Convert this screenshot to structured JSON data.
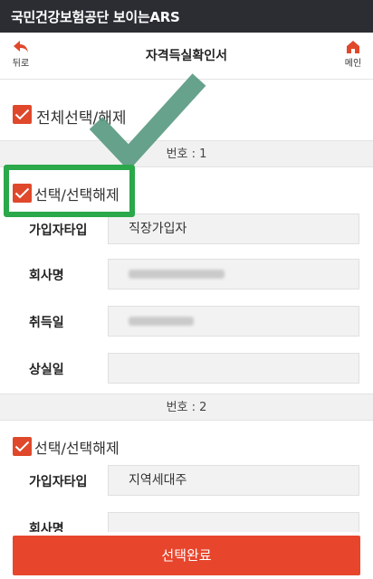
{
  "status_bar": {
    "title": "국민건강보험공단 보이는ARS"
  },
  "nav": {
    "back_label": "뒤로",
    "title": "자격득실확인서",
    "home_label": "메인"
  },
  "check_all": {
    "label": "전체선택/해제",
    "checked": true
  },
  "records": [
    {
      "header": "번호 : 1",
      "select_label": "선택/선택해제",
      "checked": true,
      "fields": [
        {
          "label": "가입자타입",
          "value": "직장가입자"
        },
        {
          "label": "회사명",
          "value": ""
        },
        {
          "label": "취득일",
          "value": ""
        },
        {
          "label": "상실일",
          "value": ""
        }
      ]
    },
    {
      "header": "번호 : 2",
      "select_label": "선택/선택해제",
      "checked": true,
      "fields": [
        {
          "label": "가입자타입",
          "value": "지역세대주"
        },
        {
          "label": "회사명",
          "value": ""
        }
      ]
    }
  ],
  "submit_label": "선택완료",
  "colors": {
    "accent": "#e8452d",
    "titlebar": "#2b2d33",
    "highlight": "#2aa84a",
    "overlay_check": "#5a9a82"
  }
}
